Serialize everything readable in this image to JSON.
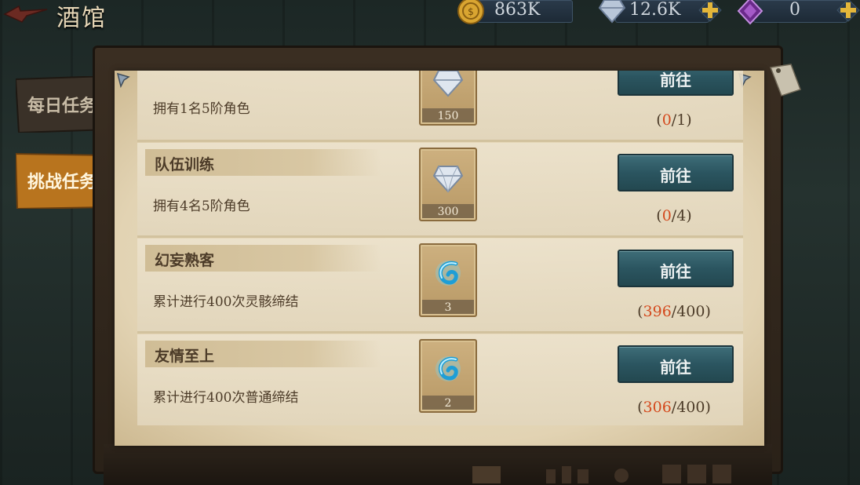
{
  "header": {
    "title": "酒馆",
    "resources": [
      {
        "icon": "gold-coin-icon",
        "value": "863K",
        "has_plus": false
      },
      {
        "icon": "diamond-icon",
        "value": "12.6K",
        "has_plus": true
      },
      {
        "icon": "purple-crystal-icon",
        "value": "0",
        "has_plus": true
      }
    ]
  },
  "tabs": [
    {
      "label": "每日任务",
      "active": false
    },
    {
      "label": "挑战任务",
      "active": true
    }
  ],
  "tasks": [
    {
      "title": "",
      "desc": "拥有1名5阶角色",
      "reward_icon": "diamond-icon",
      "reward_qty": "150",
      "button": "前往",
      "progress_cur": "0",
      "progress_total": "1"
    },
    {
      "title": "队伍训练",
      "desc": "拥有4名5阶角色",
      "reward_icon": "diamond-icon",
      "reward_qty": "300",
      "button": "前往",
      "progress_cur": "0",
      "progress_total": "4"
    },
    {
      "title": "幻妄熟客",
      "desc": "累计进行400次灵骸缔结",
      "reward_icon": "blue-swirl-token-icon",
      "reward_qty": "3",
      "button": "前往",
      "progress_cur": "396",
      "progress_total": "400"
    },
    {
      "title": "友情至上",
      "desc": "累计进行400次普通缔结",
      "reward_icon": "blue-swirl-token-icon",
      "reward_qty": "2",
      "button": "前往",
      "progress_cur": "306",
      "progress_total": "400"
    }
  ],
  "colors": {
    "progress_current": "#d4481c",
    "button": "#2b5560",
    "active_tab": "#b8741e",
    "paper": "#e6d8b8"
  }
}
